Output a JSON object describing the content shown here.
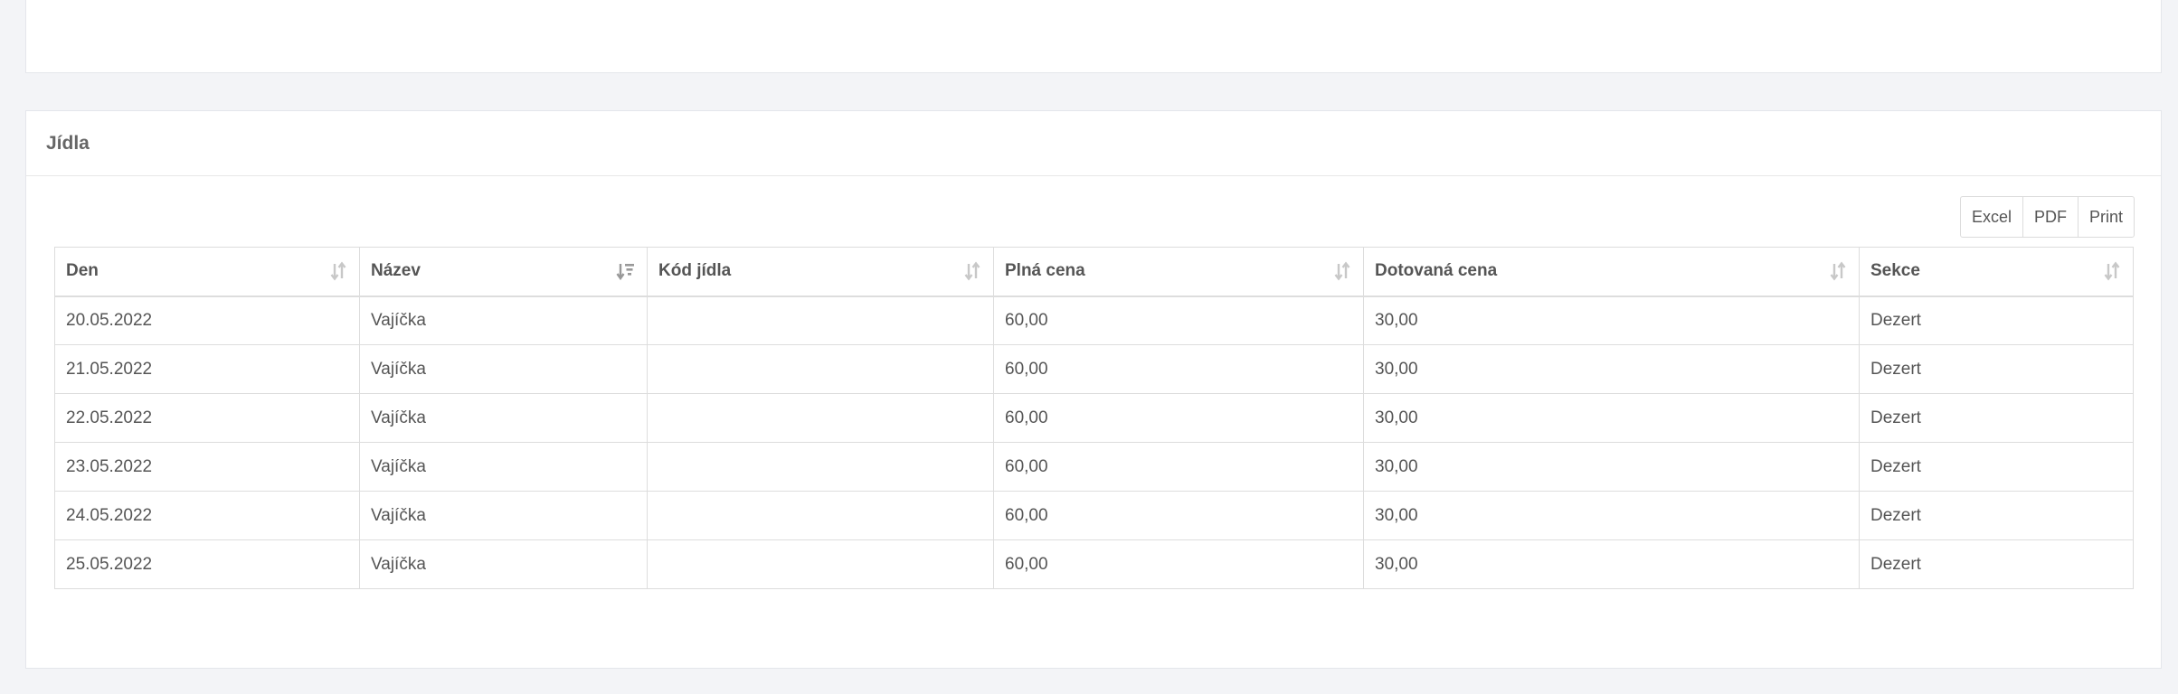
{
  "section_title": "Jídla",
  "export_buttons": [
    "Excel",
    "PDF",
    "Print"
  ],
  "table": {
    "columns": [
      "Den",
      "Název",
      "Kód jídla",
      "Plná cena",
      "Dotovaná cena",
      "Sekce"
    ],
    "sort_icons": [
      "sort-both-icon",
      "sort-active-icon",
      "sort-both-icon",
      "sort-both-icon",
      "sort-both-icon",
      "sort-both-icon"
    ],
    "rows": [
      [
        "20.05.2022",
        "Vajíčka",
        "",
        "60,00",
        "30,00",
        "Dezert"
      ],
      [
        "21.05.2022",
        "Vajíčka",
        "",
        "60,00",
        "30,00",
        "Dezert"
      ],
      [
        "22.05.2022",
        "Vajíčka",
        "",
        "60,00",
        "30,00",
        "Dezert"
      ],
      [
        "23.05.2022",
        "Vajíčka",
        "",
        "60,00",
        "30,00",
        "Dezert"
      ],
      [
        "24.05.2022",
        "Vajíčka",
        "",
        "60,00",
        "30,00",
        "Dezert"
      ],
      [
        "25.05.2022",
        "Vajíčka",
        "",
        "60,00",
        "30,00",
        "Dezert"
      ]
    ]
  },
  "colors": {
    "background": "#f3f4f7",
    "panel": "#ffffff",
    "border": "#dddddd",
    "text": "#555555",
    "sort_icon_inactive": "#c8c8c8",
    "sort_icon_active": "#999999"
  }
}
